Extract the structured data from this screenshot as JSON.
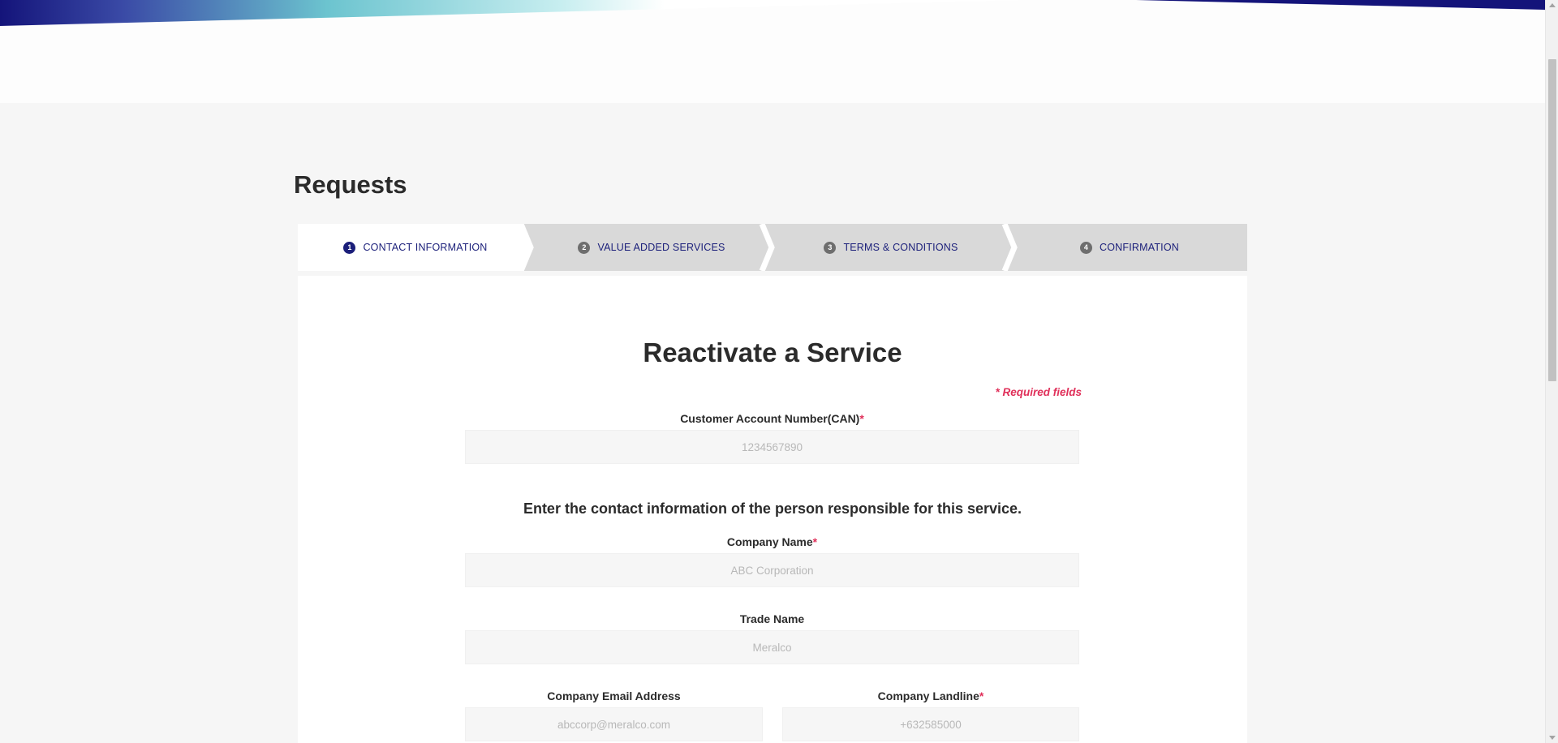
{
  "page": {
    "title": "Requests"
  },
  "brand_colors": {
    "navy": "#14147a",
    "teal": "#6cc4cf",
    "required": "#e0305a"
  },
  "stepper": {
    "steps": [
      {
        "number": "1",
        "label": "CONTACT INFORMATION",
        "active": true
      },
      {
        "number": "2",
        "label": "VALUE ADDED SERVICES",
        "active": false
      },
      {
        "number": "3",
        "label": "TERMS & CONDITIONS",
        "active": false
      },
      {
        "number": "4",
        "label": "CONFIRMATION",
        "active": false
      }
    ]
  },
  "form": {
    "title": "Reactivate a Service",
    "required_note": "* Required fields",
    "instruction": "Enter the contact information of the person responsible for this service.",
    "required_marker": "*",
    "can": {
      "label": "Customer Account Number(CAN)",
      "placeholder": "1234567890",
      "value": ""
    },
    "company_name": {
      "label": "Company Name",
      "placeholder": "ABC Corporation",
      "value": ""
    },
    "trade_name": {
      "label": "Trade Name",
      "placeholder": "Meralco",
      "value": ""
    },
    "company_email": {
      "label": "Company Email Address",
      "placeholder": "abccorp@meralco.com",
      "value": ""
    },
    "company_landline": {
      "label": "Company Landline",
      "placeholder": "+632585000",
      "value": ""
    }
  }
}
